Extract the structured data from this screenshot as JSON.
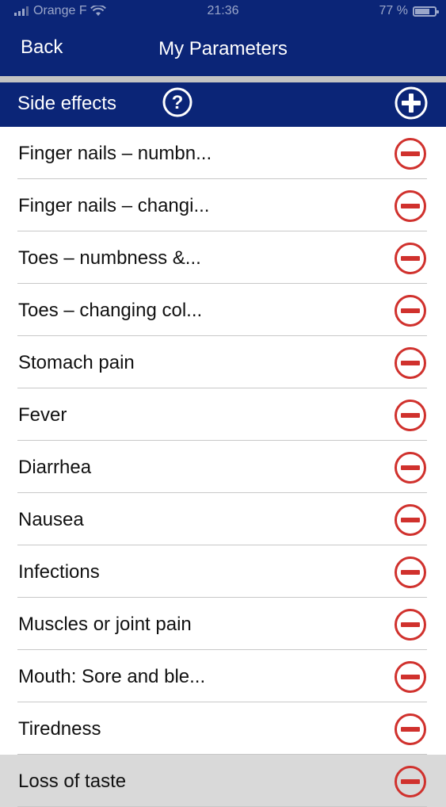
{
  "status_bar": {
    "carrier": "Orange F",
    "time": "21:36",
    "battery": "77 %",
    "battery_level": 0.77
  },
  "nav": {
    "back_label": "Back",
    "title": "My Parameters"
  },
  "section": {
    "title": "Side effects",
    "help_icon": "question-circle-icon",
    "add_icon": "plus-circle-icon"
  },
  "colors": {
    "nav_background": "#0b2577",
    "remove_red": "#d0312d",
    "divider_strip": "#c3c3c3"
  },
  "side_effects": [
    "Finger nails – numbn...",
    "Finger nails – changi...",
    "Toes – numbness &...",
    "Toes – changing col...",
    "Stomach pain",
    "Fever",
    "Diarrhea",
    "Nausea",
    "Infections",
    "Muscles or joint pain",
    "Mouth: Sore and ble...",
    "Tiredness",
    "Loss of taste"
  ]
}
